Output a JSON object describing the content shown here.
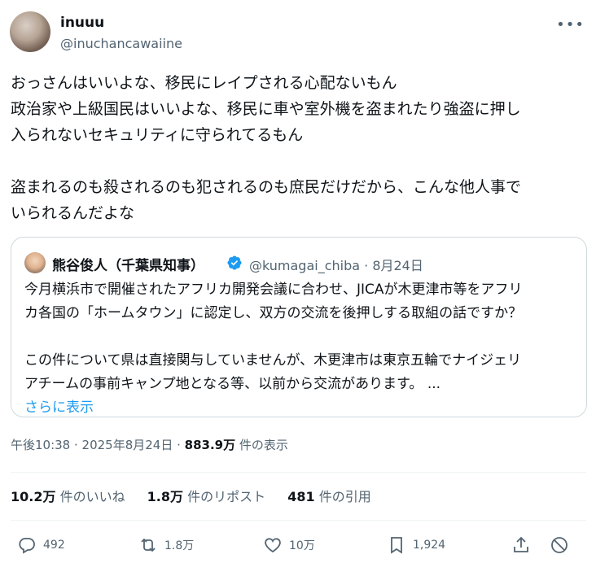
{
  "post": {
    "display_name": "inuuu",
    "handle": "@inuchancawaiine",
    "more_icon_glyph": "•••",
    "lines": [
      "おっさんはいいよな、移民にレイプされる心配ないもん",
      "政治家や上級国民はいいよな、移民に車や室外機を盗まれたり強盗に押し",
      "入られないセキュリティに守られてるもん",
      "盗まれるのも殺されるのも犯されるのも庶民だけだから、こんな他人事で",
      "いられるんだよな"
    ]
  },
  "quote": {
    "display_name": "熊谷俊人（千葉県知事）",
    "handle_and_date": "@kumagai_chiba · 8月24日",
    "lines": [
      "今月横浜市で開催されたアフリカ開発会議に合わせ、JICAが木更津市等をアフリ",
      "カ各国の「ホームタウン」に認定し、双方の交流を後押しする取組の話ですか？",
      "この件について県は直接関与していませんが、木更津市は東京五輪でナイジェリ",
      "アチームの事前キャンプ地となる等、以前から交流があります。 ..."
    ],
    "show_more": "さらに表示"
  },
  "meta": {
    "timestamp": "午後10:38 · 2025年8月24日 · ",
    "views_count": "883.9万",
    "views_label": " 件の表示"
  },
  "stats": {
    "likes_count": "10.2万",
    "likes_label": " 件のいいね",
    "reposts_count": "1.8万",
    "reposts_label": " 件のリポスト",
    "quotes_count": "481",
    "quotes_label": " 件の引用"
  },
  "actions": {
    "replies": "492",
    "reposts": "1.8万",
    "likes": "10万",
    "bookmarks": "1,924"
  },
  "colors": {
    "text": "#0f1419",
    "secondary": "#536471",
    "link": "#1d9bf0",
    "border": "#cfd9de",
    "verified": "#1d9bf0"
  },
  "icons": [
    "more-icon",
    "verified-badge-icon",
    "reply-icon",
    "repost-icon",
    "like-icon",
    "bookmark-icon",
    "share-icon",
    "block-icon"
  ]
}
